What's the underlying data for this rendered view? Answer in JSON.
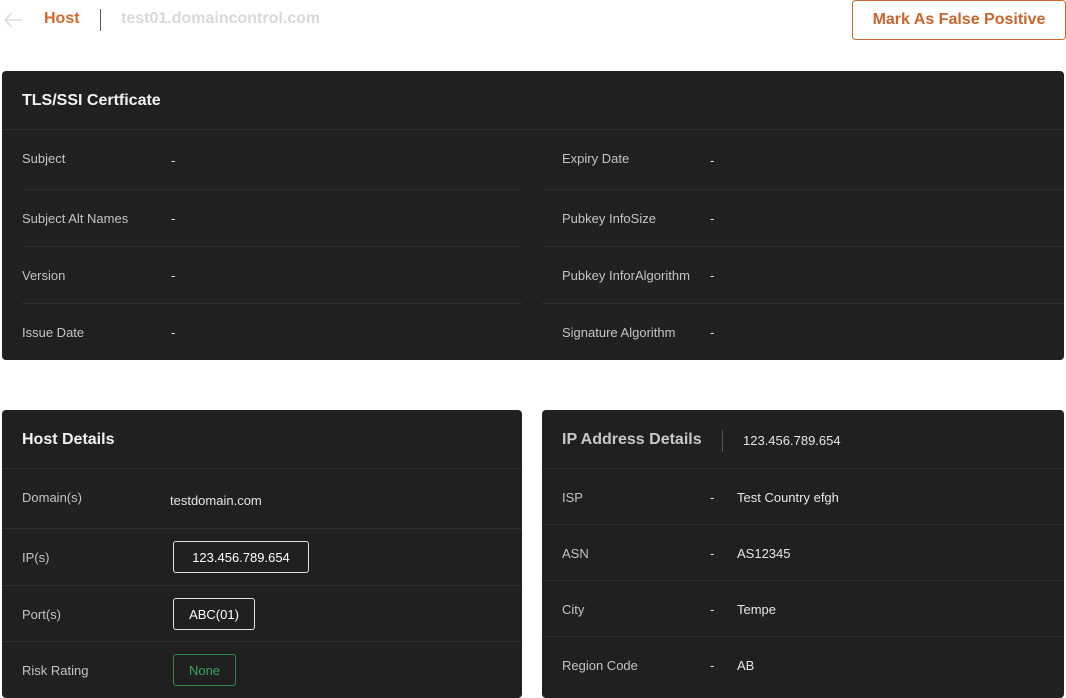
{
  "header": {
    "breadcrumb_root": "Host",
    "host_name": "test01.domaincontrol.com",
    "false_positive_label": "Mark As False Positive"
  },
  "tls": {
    "title": "TLS/SSI Certficate",
    "left": [
      {
        "label": "Subject",
        "value": "-"
      },
      {
        "label": "Subject Alt Names",
        "value": "-"
      },
      {
        "label": "Version",
        "value": "-"
      },
      {
        "label": "Issue Date",
        "value": "-"
      }
    ],
    "right": [
      {
        "label": "Expiry Date",
        "value": "-"
      },
      {
        "label": "Pubkey InfoSize",
        "value": "-"
      },
      {
        "label": "Pubkey InforAlgorithm",
        "value": "-"
      },
      {
        "label": "Signature Algorithm",
        "value": "-"
      }
    ]
  },
  "host_details": {
    "title": "Host Details",
    "domains_label": "Domain(s)",
    "domains_value": "testdomain.com",
    "ips_label": "IP(s)",
    "ips_value": "123.456.789.654",
    "ports_label": "Port(s)",
    "ports_value": "ABC(01)",
    "risk_label": "Risk Rating",
    "risk_value": "None"
  },
  "ip_details": {
    "title": "IP Address Details",
    "ip": "123.456.789.654",
    "rows": [
      {
        "label": "ISP",
        "dash": "-",
        "value": "Test Country efgh"
      },
      {
        "label": "ASN",
        "dash": "-",
        "value": "AS12345"
      },
      {
        "label": "City",
        "dash": "-",
        "value": "Tempe"
      },
      {
        "label": "Region Code",
        "dash": "-",
        "value": "AB"
      }
    ]
  },
  "colors": {
    "accent": "#d4692a",
    "card_bg": "#202020",
    "risk_green": "#39a85a"
  }
}
